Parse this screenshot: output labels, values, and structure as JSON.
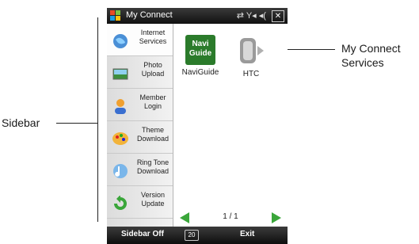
{
  "callouts": {
    "sidebar_label": "Sidebar",
    "services_label_line1": "My Connect",
    "services_label_line2": "Services"
  },
  "window": {
    "title": "My Connect",
    "close_glyph": "✕",
    "status_glyphs": "⇄ Y◂ ◂("
  },
  "sidebar": {
    "items": [
      {
        "line1": "Internet",
        "line2": "Services",
        "icon": "globe-icon",
        "selected": true
      },
      {
        "line1": "Photo",
        "line2": "Upload",
        "icon": "photo-icon",
        "selected": false
      },
      {
        "line1": "Member",
        "line2": "Login",
        "icon": "person-icon",
        "selected": false
      },
      {
        "line1": "Theme",
        "line2": "Download",
        "icon": "palette-icon",
        "selected": false
      },
      {
        "line1": "Ring Tone",
        "line2": "Download",
        "icon": "music-note-icon",
        "selected": false
      },
      {
        "line1": "Version",
        "line2": "Update",
        "icon": "refresh-icon",
        "selected": false
      }
    ]
  },
  "services": {
    "items": [
      {
        "label": "NaviGuide",
        "logo_line1": "Navi",
        "logo_line2": "Guide"
      },
      {
        "label": "HTC"
      }
    ]
  },
  "pager": {
    "text": "1 / 1"
  },
  "softkeys": {
    "left": "Sidebar Off",
    "center": "20",
    "right": "Exit"
  },
  "colors": {
    "accent_green": "#3aa63a",
    "titlebar": "#1a1a1a"
  }
}
